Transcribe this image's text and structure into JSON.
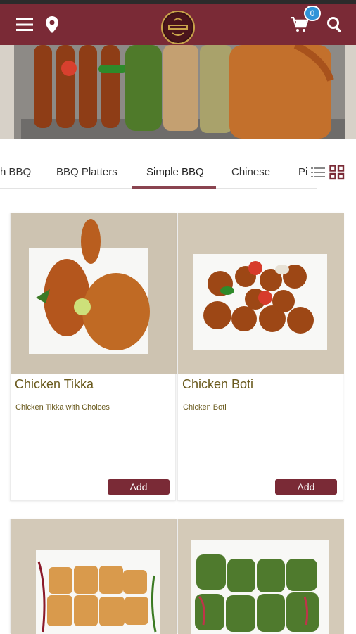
{
  "header": {
    "menu_icon": "hamburger-menu-icon",
    "location_icon": "map-pin-icon",
    "logo_name": "restaurant-logo",
    "cart_icon": "cart-icon",
    "cart_count": "0",
    "search_icon": "search-icon",
    "color": "#7a2a36"
  },
  "categories": {
    "tabs": [
      {
        "label": "h BBQ"
      },
      {
        "label": "BBQ Platters"
      },
      {
        "label": "Simple BBQ"
      },
      {
        "label": "Chinese"
      },
      {
        "label": "Pi"
      }
    ],
    "active": "Simple BBQ",
    "list_view_icon": "list-view-icon",
    "grid_view_icon": "grid-view-icon"
  },
  "products": [
    {
      "name": "Chicken Tikka",
      "description": "Chicken Tikka with Choices",
      "add_label": "Add"
    },
    {
      "name": "Chicken Boti",
      "description": "Chicken Boti",
      "add_label": "Add"
    },
    {
      "name": "",
      "description": "",
      "add_label": ""
    },
    {
      "name": "",
      "description": "",
      "add_label": ""
    }
  ],
  "colors": {
    "brand": "#7a2a36",
    "badge": "#2f93d8",
    "title_text": "#6a5a1e"
  }
}
